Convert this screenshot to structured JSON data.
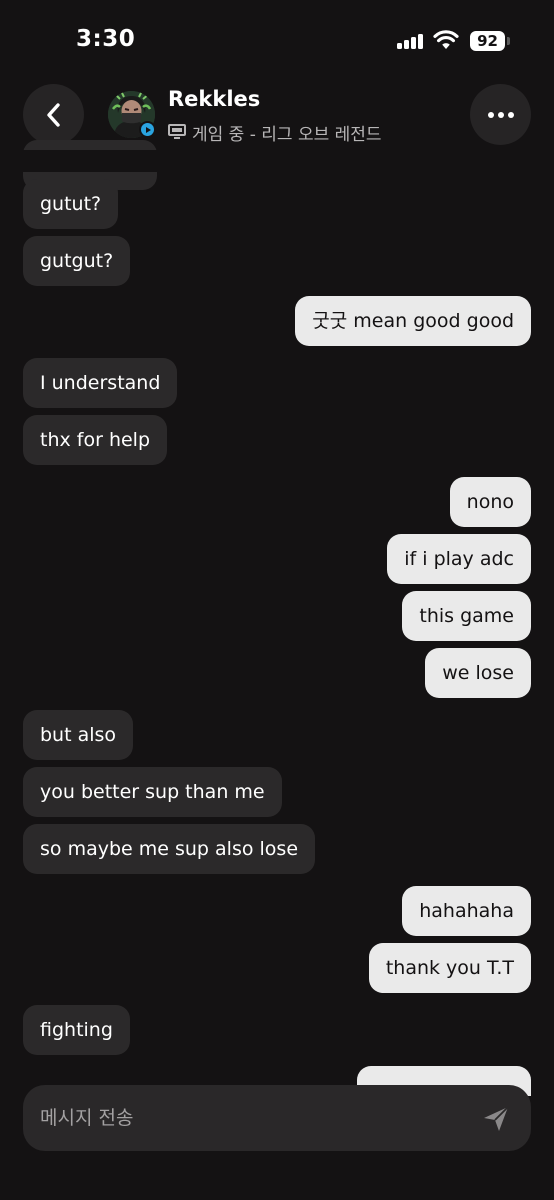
{
  "status_bar": {
    "time": "3:30",
    "battery": "92",
    "icons": [
      "cellular-signal-icon",
      "wifi-icon",
      "battery-icon"
    ]
  },
  "header": {
    "back_icon": "chevron-left-icon",
    "contact_name": "Rekkles",
    "presence": "게임 중 - 리그 오브 레전드",
    "presence_icon": "monitor-icon",
    "more_icon": "ellipsis-icon"
  },
  "messages": [
    {
      "side": "in",
      "text": "gutut?"
    },
    {
      "side": "in",
      "text": "gutgut?"
    },
    {
      "side": "out",
      "text": "굿굿 mean good good"
    },
    {
      "side": "in",
      "text": "I understand"
    },
    {
      "side": "in",
      "text": "thx for help"
    },
    {
      "side": "out",
      "text": "nono"
    },
    {
      "side": "out",
      "text": "if i play adc"
    },
    {
      "side": "out",
      "text": "this game"
    },
    {
      "side": "out",
      "text": "we lose"
    },
    {
      "side": "in",
      "text": "but also"
    },
    {
      "side": "in",
      "text": "you better sup than me"
    },
    {
      "side": "in",
      "text": "so maybe me sup also lose"
    },
    {
      "side": "out",
      "text": "hahahaha"
    },
    {
      "side": "out",
      "text": "thank you T.T"
    },
    {
      "side": "in",
      "text": "fighting"
    }
  ],
  "composer": {
    "placeholder": "메시지 전송",
    "value": "",
    "send_icon": "send-icon"
  },
  "colors": {
    "background": "#141213",
    "incoming_bubble": "#2b292a",
    "outgoing_bubble": "#eaeaea",
    "accent": "#2aa4e0"
  }
}
